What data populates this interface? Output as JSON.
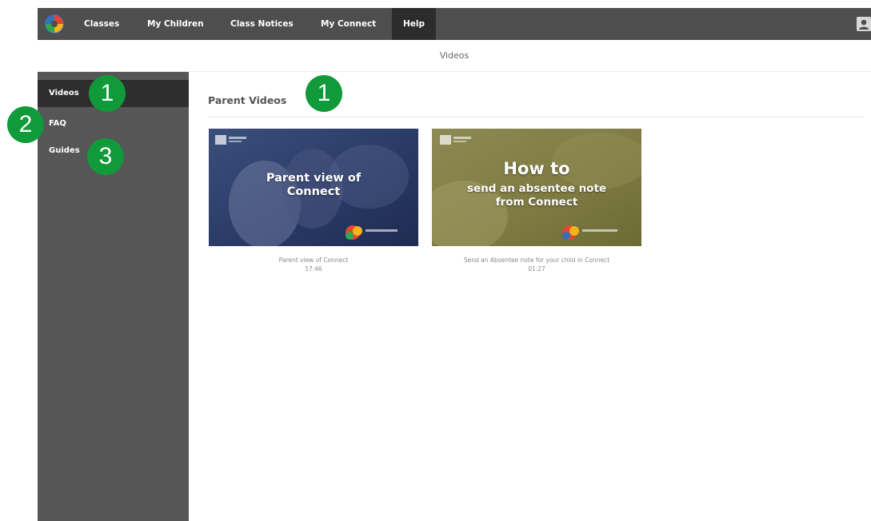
{
  "topnav": {
    "items": [
      {
        "label": "Classes"
      },
      {
        "label": "My Children"
      },
      {
        "label": "Class Notices"
      },
      {
        "label": "My Connect"
      },
      {
        "label": "Help"
      }
    ],
    "active_index": 4,
    "logo_icon": "connect-logo-icon",
    "user_icon": "user-icon"
  },
  "page": {
    "title": "Videos"
  },
  "sidebar": {
    "items": [
      {
        "label": "Videos",
        "active": true
      },
      {
        "label": "FAQ",
        "active": false
      },
      {
        "label": "Guides",
        "active": false
      }
    ]
  },
  "main": {
    "section_title": "Parent Videos",
    "videos": [
      {
        "thumb_text": "Parent view of Connect",
        "title": "Parent view of Connect",
        "duration": "17:46"
      },
      {
        "thumb_heading": "How to",
        "thumb_text": "send an absentee note from Connect",
        "title": "Send an Absentee note for your child in Connect",
        "duration": "01:27"
      }
    ]
  },
  "callouts": [
    "1",
    "2",
    "3",
    "1"
  ],
  "colors": {
    "nav_bg": "#4e4e4e",
    "nav_active_bg": "#2c2c2c",
    "sidebar_bg": "#565656",
    "sidebar_active_bg": "#2e2e2e",
    "callout_green": "#109a3a"
  }
}
